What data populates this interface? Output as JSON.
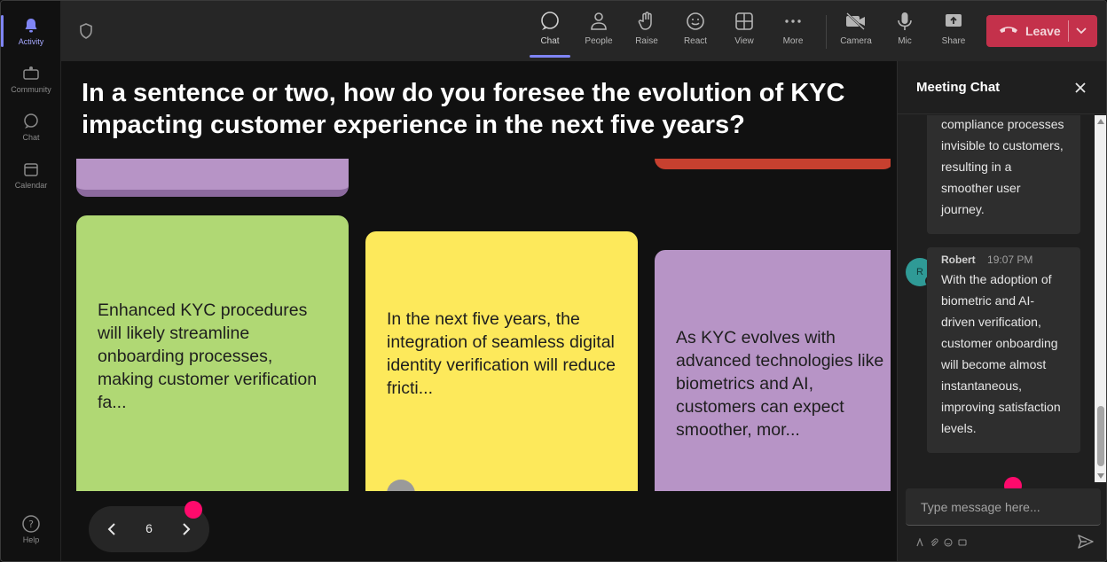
{
  "rail": {
    "items": [
      {
        "label": "Activity",
        "icon": "bell-icon",
        "active": true
      },
      {
        "label": "Community",
        "icon": "community-icon"
      },
      {
        "label": "Chat",
        "icon": "chat-icon"
      },
      {
        "label": "Calendar",
        "icon": "calendar-icon"
      },
      {
        "label": "Help",
        "icon": "help-icon"
      }
    ]
  },
  "toolbar": {
    "chat": "Chat",
    "people": "People",
    "raise": "Raise",
    "react": "React",
    "view": "View",
    "more": "More",
    "camera": "Camera",
    "mic": "Mic",
    "share": "Share",
    "leave": "Leave"
  },
  "stage": {
    "question": "In a sentence or two, how do you foresee the evolution of KYC impacting customer experience in the next five years?",
    "cards": {
      "green": "Enhanced KYC procedures will likely streamline onboarding processes, making customer verification fa...",
      "yellow": "In the next five years, the integration of seamless digital identity verification will reduce fricti...",
      "purple": "As KYC evolves with advanced technologies like biometrics and AI, customers can expect smoother, mor..."
    },
    "pager": {
      "page": "6"
    }
  },
  "chat": {
    "title": "Meeting Chat",
    "messages": [
      {
        "text": "compliance processes invisible to customers, resulting in a smoother user journey."
      },
      {
        "author": "Robert",
        "time": "19:07 PM",
        "avatar_initial": "R",
        "text": "With the adoption of biometric and AI-driven verification, customer onboarding will become almost instantaneous, improving satisfaction levels."
      }
    ],
    "input_placeholder": "Type message here..."
  },
  "colors": {
    "accent": "#7f85f5",
    "leave": "#c4314b",
    "card_green": "#b0d874",
    "card_yellow": "#fde95b",
    "card_purple": "#b794c6",
    "highlight_dot": "#ff0a6c"
  }
}
